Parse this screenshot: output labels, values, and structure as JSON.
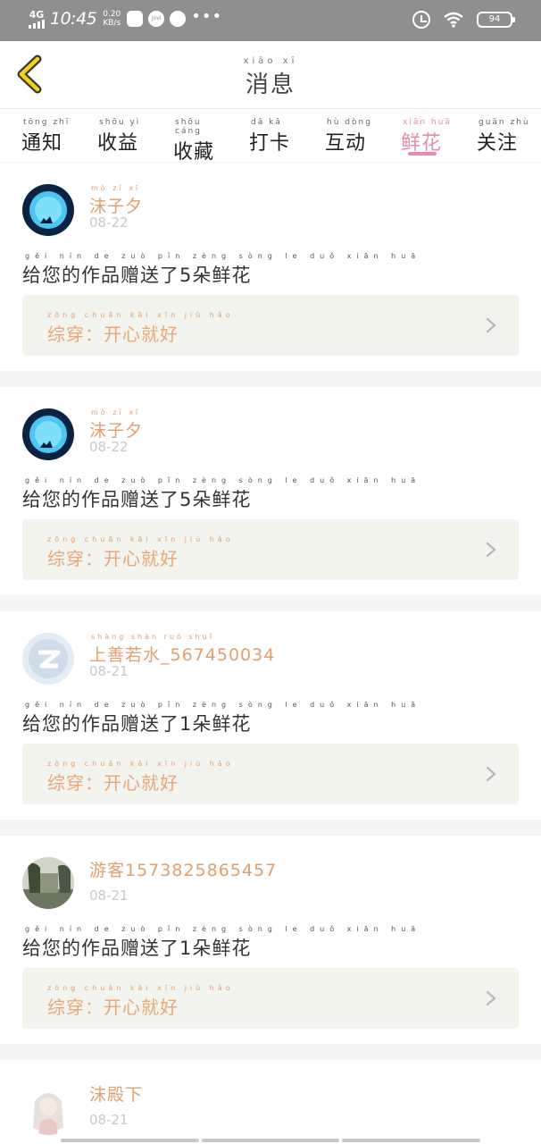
{
  "status_bar": {
    "network": "4G",
    "time": "10:45",
    "speed_value": "0.20",
    "speed_unit": "KB/s",
    "vivo_label": "Jovi",
    "more": "•••",
    "battery": "94"
  },
  "header": {
    "title_pinyin": "xiāo xī",
    "title": "消息"
  },
  "tabs": [
    {
      "pinyin": "tōng zhī",
      "label": "通知",
      "active": false
    },
    {
      "pinyin": "shōu yì",
      "label": "收益",
      "active": false
    },
    {
      "pinyin": "shōu cáng",
      "label": "收藏",
      "active": false
    },
    {
      "pinyin": "dǎ kǎ",
      "label": "打卡",
      "active": false
    },
    {
      "pinyin": "hù dòng",
      "label": "互动",
      "active": false
    },
    {
      "pinyin": "xiān huā",
      "label": "鲜花",
      "active": true
    },
    {
      "pinyin": "guān zhù",
      "label": "关注",
      "active": false
    }
  ],
  "messages": [
    {
      "user_pinyin": "mò zǐ xī",
      "user": "沫子夕",
      "date": "08-22",
      "content_pinyin": "gěi nín de zuò pǐn zèng sòng le duǒ xiān huā",
      "content": "给您的作品赠送了5朵鲜花",
      "work_pinyin": "zōng chuān kāi xīn jiù hǎo",
      "work": "综穿：开心就好"
    },
    {
      "user_pinyin": "mò zǐ xī",
      "user": "沫子夕",
      "date": "08-22",
      "content_pinyin": "gěi nín de zuò pǐn zèng sòng le duǒ xiān huā",
      "content": "给您的作品赠送了5朵鲜花",
      "work_pinyin": "zōng chuān kāi xīn jiù hǎo",
      "work": "综穿：开心就好"
    },
    {
      "user_pinyin": "shàng shàn ruò shuǐ",
      "user": "上善若水_567450034",
      "date": "08-21",
      "content_pinyin": "gěi nín de zuò pǐn zèng sòng le duǒ xiān huā",
      "content": "给您的作品赠送了1朵鲜花",
      "work_pinyin": "zōng chuān kāi xīn jiù hǎo",
      "work": "综穿：开心就好"
    },
    {
      "user_pinyin": "",
      "user": "游客15738258654​57",
      "date": "08-21",
      "content_pinyin": "gěi nín de zuò pǐn zèng sòng le duǒ xiān huā",
      "content": "给您的作品赠送了1朵鲜花",
      "work_pinyin": "zōng chuān kāi xīn jiù hǎo",
      "work": "综穿：开心就好"
    },
    {
      "user_pinyin": "",
      "user": "沫殿下",
      "date": "08-21"
    }
  ],
  "colors": {
    "accent_pink": "#e98bb0",
    "username_orange": "#e0a070",
    "card_bg": "#f4f4ee"
  }
}
